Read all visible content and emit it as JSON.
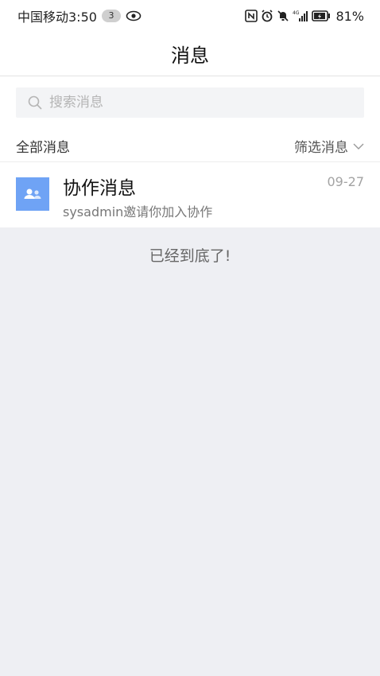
{
  "status_bar": {
    "carrier_time": "中国移动3:50",
    "notification_count": "3",
    "battery": "81%"
  },
  "header": {
    "title": "消息"
  },
  "search": {
    "placeholder": "搜索消息"
  },
  "filter": {
    "all_label": "全部消息",
    "filter_label": "筛选消息"
  },
  "messages": [
    {
      "title": "协作消息",
      "subtitle": "sysadmin邀请你加入协作",
      "date": "09-27",
      "avatar_color": "#6fa3f5",
      "icon": "group-icon"
    }
  ],
  "footer": {
    "end_text": "已经到底了!"
  },
  "colors": {
    "background": "#eeeff3",
    "surface": "#ffffff",
    "accent": "#6fa3f5"
  }
}
